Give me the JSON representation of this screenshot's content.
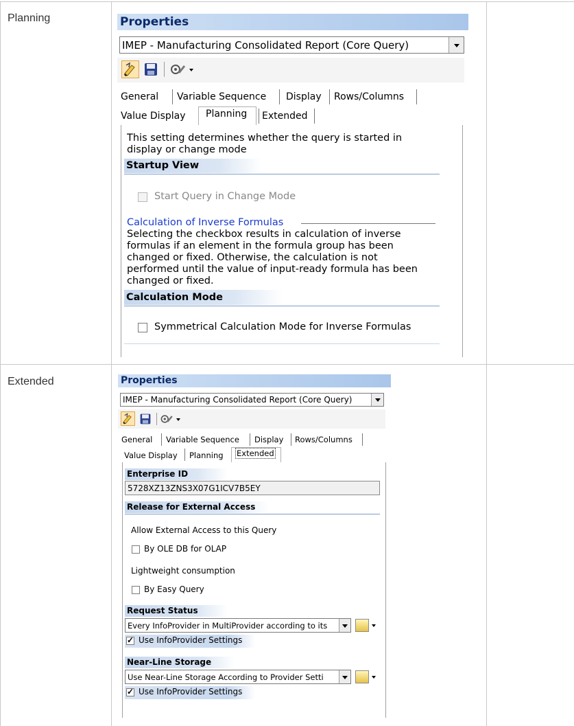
{
  "rows": [
    {
      "label": "Planning"
    },
    {
      "label": "Extended"
    }
  ],
  "planning_panel": {
    "title": "Properties",
    "query_select": "IMEP - Manufacturing Consolidated Report (Core Query)",
    "tabs_row1": [
      "General",
      "Variable Sequence",
      "Display",
      "Rows/Columns"
    ],
    "tabs_row2": [
      "Value Display",
      "Planning",
      "Extended"
    ],
    "active_tab": "Planning",
    "description": [
      "This setting determines whether the query is started in",
      "display or change mode"
    ],
    "startup_view": {
      "heading": "Startup View",
      "checkbox_label": "Start Query in Change Mode",
      "checked": false,
      "disabled": true
    },
    "inverse": {
      "heading": "Calculation of Inverse Formulas",
      "text": [
        "Selecting the checkbox results in calculation of inverse",
        "formulas if an element in the formula group has been",
        "changed or fixed. Otherwise, the calculation is not",
        "performed until the value of input-ready formula has been",
        "changed or fixed."
      ]
    },
    "calc_mode": {
      "heading": "Calculation Mode",
      "checkbox_label": "Symmetrical Calculation Mode for Inverse Formulas",
      "checked": false
    }
  },
  "extended_panel": {
    "title": "Properties",
    "query_select": "IMEP - Manufacturing Consolidated Report (Core Query)",
    "tabs_row1": [
      "General",
      "Variable Sequence",
      "Display",
      "Rows/Columns"
    ],
    "tabs_row2": [
      "Value Display",
      "Planning",
      "Extended"
    ],
    "active_tab": "Extended",
    "enterprise_id": {
      "heading": "Enterprise ID",
      "value": "5728XZ13ZNS3X07G1ICV7B5EY"
    },
    "release": {
      "heading": "Release for External Access",
      "allow_text": "Allow External Access to this Query",
      "olap_label": "By OLE DB for OLAP",
      "olap_checked": false,
      "lightweight_text": "Lightweight consumption",
      "easy_label": "By Easy Query",
      "easy_checked": false
    },
    "request_status": {
      "heading": "Request Status",
      "select": "Every InfoProvider in MultiProvider according to its",
      "use_label": "Use InfoProvider Settings",
      "use_checked": true
    },
    "nearline": {
      "heading": "Near-Line Storage",
      "select": "Use Near-Line Storage According to Provider Setti",
      "use_label": "Use InfoProvider Settings",
      "use_checked": true
    }
  },
  "icons": [
    "edit-icon",
    "save-icon",
    "tools-icon",
    "chevron-down-icon",
    "variable-picker-icon"
  ],
  "colors": {
    "title_gradient": "#a9c6ea",
    "section_head": "#c7d8ee",
    "link_blue": "#1a3ccc"
  }
}
